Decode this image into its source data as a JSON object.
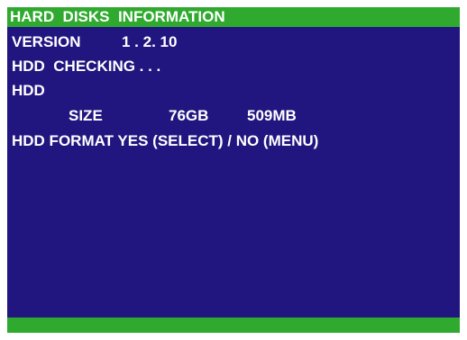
{
  "screen": {
    "title": "HARD  DISKS  INFORMATION",
    "version_label": "VERSION",
    "version_value": "1 . 2. 10",
    "hdd_checking": "HDD  CHECKING . . .",
    "hdd_label": "HDD",
    "size_label": "SIZE",
    "size_gb": "76GB",
    "size_mb": "509MB",
    "format_prompt": "HDD FORMAT YES (SELECT) / NO (MENU)"
  },
  "colors": {
    "background": "#211580",
    "bar": "#2faa2f",
    "text": "#ffffff"
  }
}
